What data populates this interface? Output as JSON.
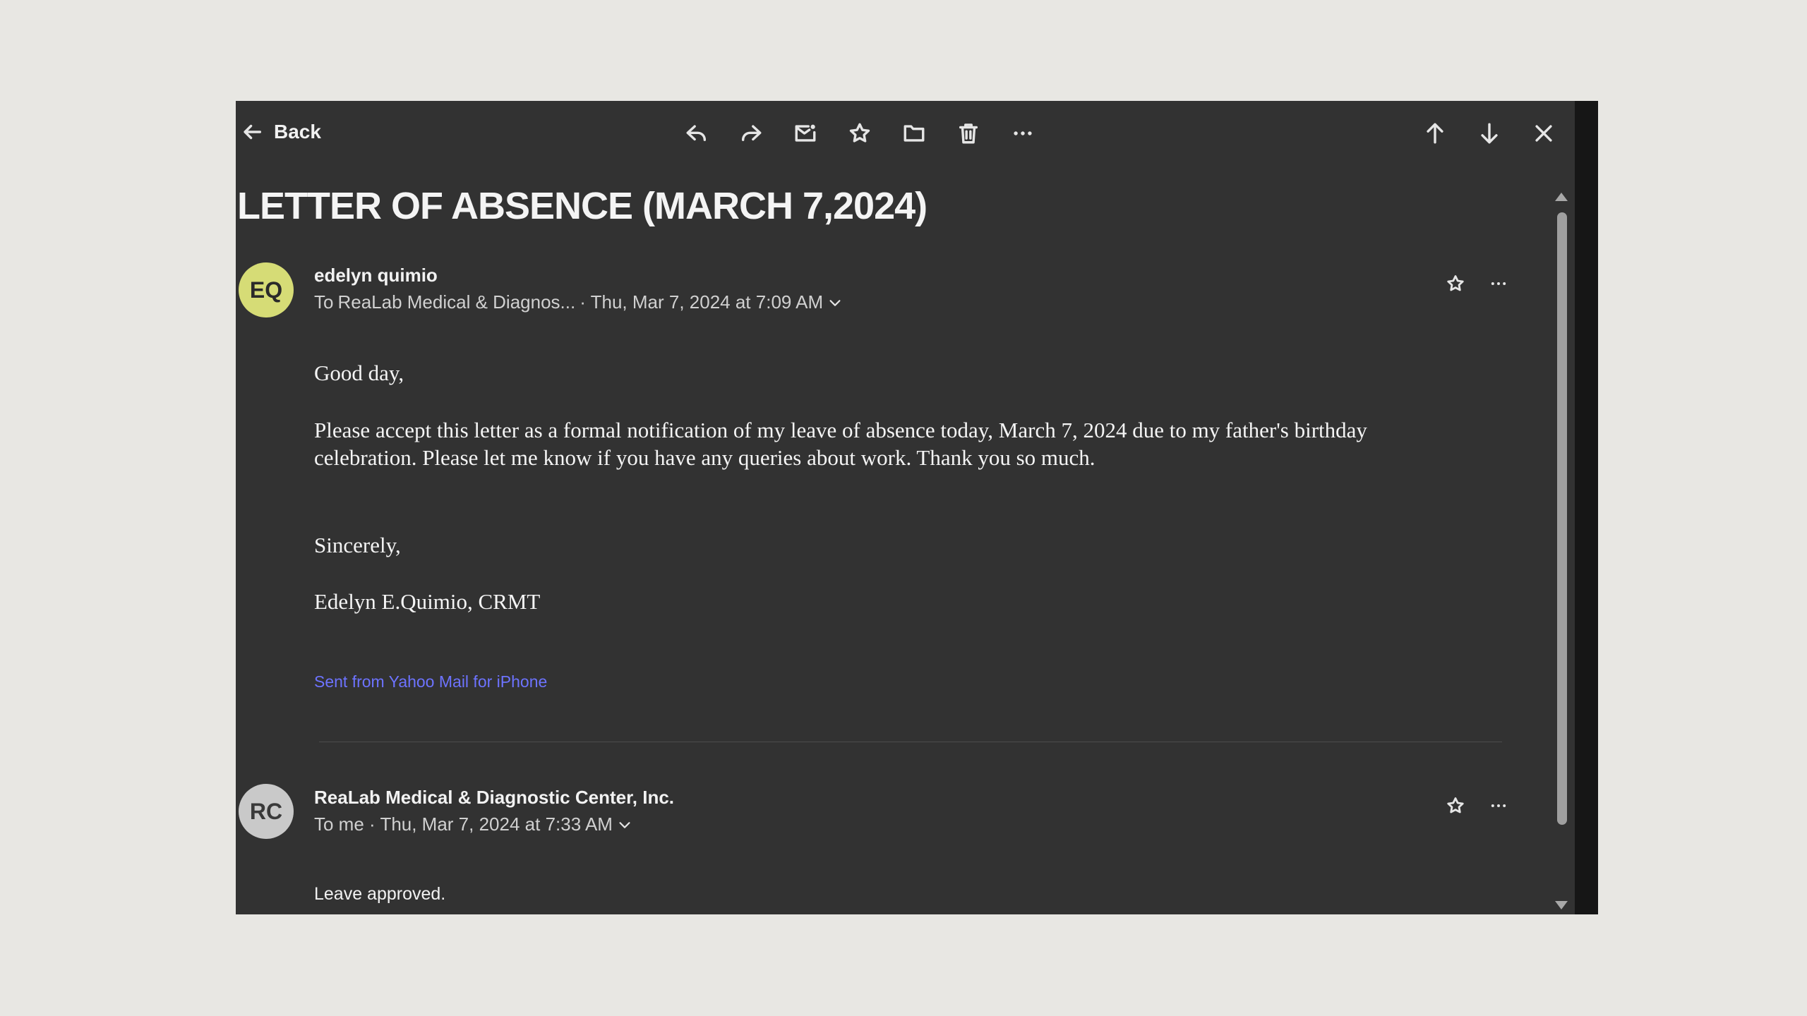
{
  "toolbar": {
    "back_label": "Back",
    "actions": [
      "reply-icon",
      "forward-icon",
      "mark-unread-icon",
      "star-icon",
      "move-folder-icon",
      "delete-icon",
      "more-icon"
    ],
    "nav": [
      "previous-icon",
      "next-icon",
      "close-icon"
    ]
  },
  "email": {
    "subject": "LETTER OF ABSENCE (MARCH 7,2024)"
  },
  "messages": [
    {
      "initials": "EQ",
      "avatar_color": "#d6dc76",
      "sender": "edelyn quimio",
      "to_prefix": "To",
      "recipient": "ReaLab Medical & Diagnos...",
      "date": "· Thu, Mar 7, 2024 at 7:09 AM",
      "body": {
        "greeting": "Good day,",
        "paragraph": "Please accept this letter as a formal notification of my leave of absence today, March 7, 2024 due to my father's birthday celebration. Please let me know if you have any queries about work. Thank you so much.",
        "closing": "Sincerely,",
        "signature": "Edelyn E.Quimio, CRMT"
      },
      "footer_link": "Sent from Yahoo Mail for iPhone"
    },
    {
      "initials": "RC",
      "avatar_color": "#c9c9c9",
      "sender": "ReaLab Medical & Diagnostic Center, Inc.",
      "meta": "To me · Thu, Mar 7, 2024 at 7:33 AM",
      "body": "Leave approved."
    }
  ]
}
